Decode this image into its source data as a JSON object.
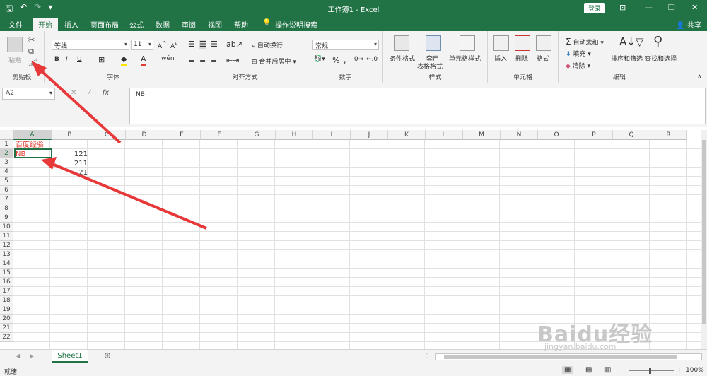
{
  "titlebar": {
    "title": "工作簿1 - Excel",
    "login_label": "登录"
  },
  "tabs": [
    "文件",
    "开始",
    "插入",
    "页面布局",
    "公式",
    "数据",
    "审阅",
    "视图",
    "帮助"
  ],
  "tell_me": "操作说明搜索",
  "share": "共享",
  "ribbon": {
    "clipboard": {
      "paste": "粘贴",
      "label": "剪贴板"
    },
    "font": {
      "name": "等线",
      "size": "11",
      "label": "字体"
    },
    "alignment": {
      "wrap": "自动换行",
      "merge": "合并后居中",
      "label": "对齐方式"
    },
    "number": {
      "format": "常规",
      "label": "数字"
    },
    "styles": {
      "conditional": "条件格式",
      "table": "套用",
      "table2": "表格格式",
      "cell_styles": "单元格样式",
      "label": "样式"
    },
    "cells": {
      "insert": "插入",
      "delete": "删除",
      "format": "格式",
      "label": "单元格"
    },
    "editing": {
      "autosum": "自动求和",
      "fill": "填充",
      "clear": "清除",
      "sort": "排序和筛选",
      "find": "查找和选择",
      "label": "编辑"
    }
  },
  "formula_bar": {
    "name_box": "A2",
    "fx": "fx",
    "value": "NB"
  },
  "columns": [
    "A",
    "B",
    "C",
    "D",
    "E",
    "F",
    "G",
    "H",
    "I",
    "J",
    "K",
    "L",
    "M",
    "N",
    "O",
    "P",
    "Q",
    "R"
  ],
  "rows": [
    "1",
    "2",
    "3",
    "4",
    "5",
    "6",
    "7",
    "8",
    "9",
    "10",
    "11",
    "12",
    "13",
    "14",
    "15",
    "16",
    "17",
    "18",
    "19",
    "20",
    "21",
    "22"
  ],
  "cells": {
    "a1": "百度经验",
    "a2": "NB",
    "b2": "121",
    "b3": "211",
    "b4": "21"
  },
  "sheet_tab": "Sheet1",
  "status": {
    "ready": "就绪",
    "zoom": "100%"
  },
  "watermark": {
    "main": "Baidu经验",
    "sub": "jingyan.baidu.com"
  },
  "colors": {
    "excel_green": "#217346",
    "red_text": "#e03c31",
    "arrow": "#e8393a"
  }
}
